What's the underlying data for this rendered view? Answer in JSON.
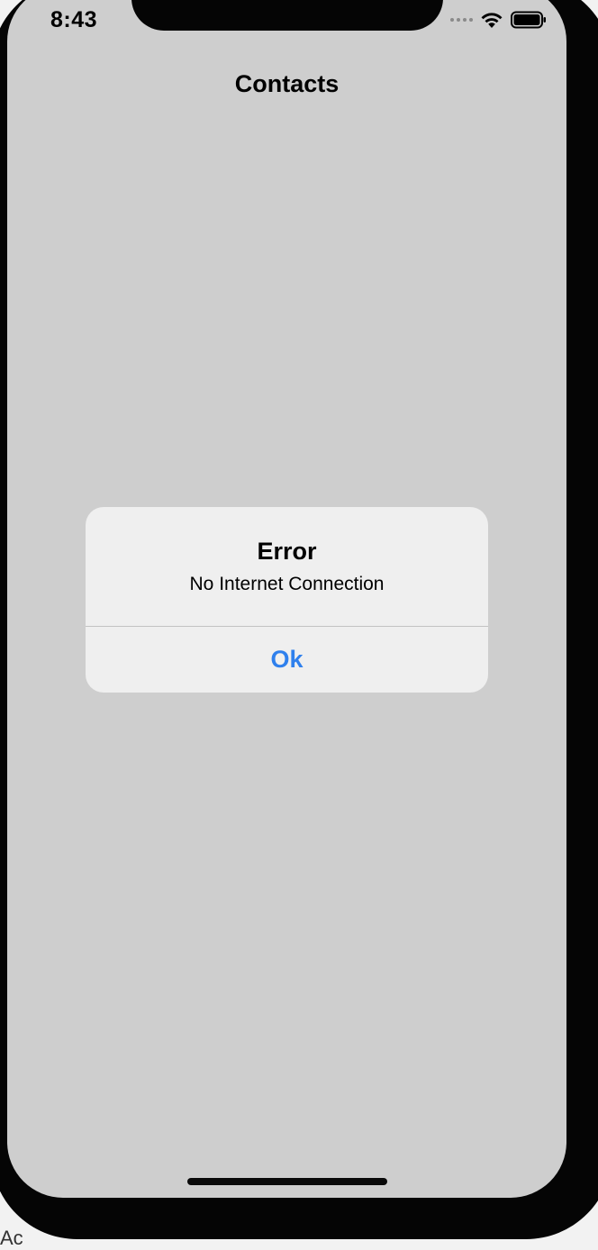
{
  "status_bar": {
    "time": "8:43",
    "icons": [
      "cellular-dots-icon",
      "wifi-icon",
      "battery-icon"
    ]
  },
  "nav": {
    "title": "Contacts"
  },
  "alert": {
    "title": "Error",
    "message": "No Internet Connection",
    "button_label": "Ok"
  },
  "colors": {
    "accent": "#2f80ed",
    "screen_background": "#cecece",
    "alert_background": "#efefef"
  },
  "corner_text": "Ac"
}
